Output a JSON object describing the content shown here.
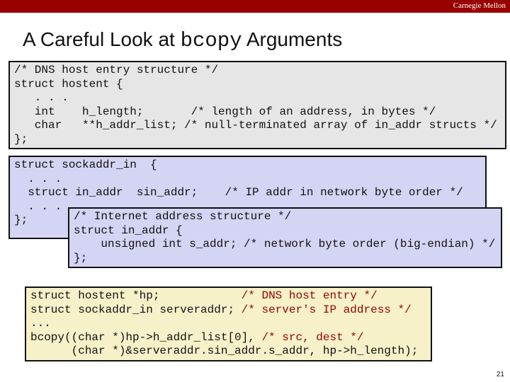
{
  "header": {
    "brand": "Carnegie Mellon",
    "brand_color": "#990000"
  },
  "title": {
    "prefix": "A Careful Look at ",
    "code": "bcopy",
    "suffix": " Arguments"
  },
  "hostent_box": {
    "lines": [
      "/* DNS host entry structure */",
      "struct hostent {",
      "   . . .",
      "   int    h_length;       /* length of an address, in bytes */",
      "   char   **h_addr_list; /* null-terminated array of in_addr structs */",
      "};"
    ]
  },
  "sockaddr_box": {
    "lines": [
      "struct sockaddr_in  {",
      "  . . .",
      "  struct in_addr  sin_addr;    /* IP addr in network byte order */",
      "  . . .",
      "};"
    ]
  },
  "in_addr_box": {
    "lines": [
      "/* Internet address structure */",
      "struct in_addr {",
      "    unsigned int s_addr; /* network byte order (big-endian) */",
      "};"
    ]
  },
  "usage_box": {
    "lines": [
      {
        "code": "struct hostent *hp;            ",
        "comment": "/* DNS host entry */"
      },
      {
        "code": "struct sockaddr_in serveraddr; ",
        "comment": "/* server's IP address */"
      },
      {
        "code": "...",
        "comment": ""
      },
      {
        "code": "bcopy((char *)hp->h_addr_list[0], ",
        "comment": "/* src, dest */"
      },
      {
        "code": "      (char *)&serveraddr.sin_addr.s_addr, hp->h_length);",
        "comment": ""
      }
    ]
  },
  "page_number": "21"
}
